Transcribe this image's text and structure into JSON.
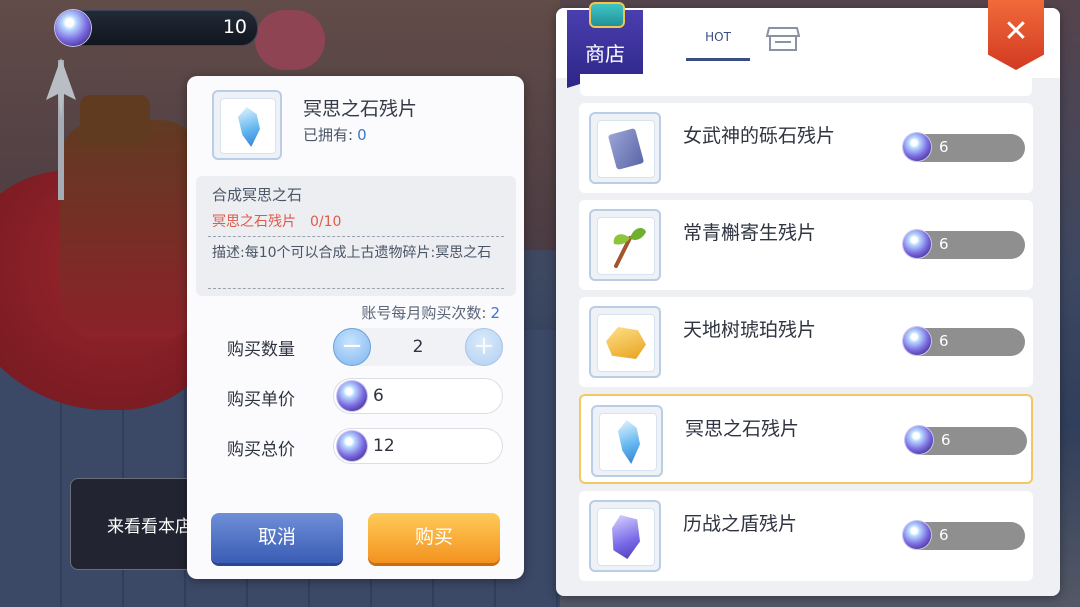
{
  "currency": {
    "icon": "gem-icon",
    "amount": "10"
  },
  "toast": {
    "text": "来看看本店"
  },
  "dialog": {
    "item_name": "冥思之石残片",
    "owned_label": "已拥有:",
    "owned_value": "0",
    "craft_title": "合成冥思之石",
    "craft_requirement": "冥思之石残片",
    "craft_count": "0/10",
    "description": "描述:每10个可以合成上古遗物碎片:冥思之石",
    "limit_label": "账号每月购买次数:",
    "limit_value": "2",
    "qty_label": "购买数量",
    "qty_value": "2",
    "unit_price_label": "购买单价",
    "unit_price_value": "6",
    "total_price_label": "购买总价",
    "total_price_value": "12",
    "cancel_label": "取消",
    "buy_label": "购买"
  },
  "shop": {
    "title": "商店",
    "tabs": [
      {
        "label": "HOT",
        "active": true
      },
      {
        "label": "",
        "icon": "store-icon",
        "active": false
      }
    ],
    "items": [
      {
        "name": "女武神的砾石残片",
        "price": "6",
        "icon": "stone-icon",
        "selected": false
      },
      {
        "name": "常青槲寄生残片",
        "price": "6",
        "icon": "sprout-icon",
        "selected": false
      },
      {
        "name": "天地树琥珀残片",
        "price": "6",
        "icon": "amber-icon",
        "selected": false
      },
      {
        "name": "冥思之石残片",
        "price": "6",
        "icon": "crystal-icon",
        "selected": true
      },
      {
        "name": "历战之盾残片",
        "price": "6",
        "icon": "shield-shard-icon",
        "selected": false
      }
    ]
  },
  "colors": {
    "accent_blue": "#3a78c8",
    "warning_red": "#e05a4a",
    "buy_orange": "#f3921f",
    "cancel_blue": "#3a5cb4",
    "selected_border": "#f3c864",
    "close_red": "#d23a22"
  }
}
